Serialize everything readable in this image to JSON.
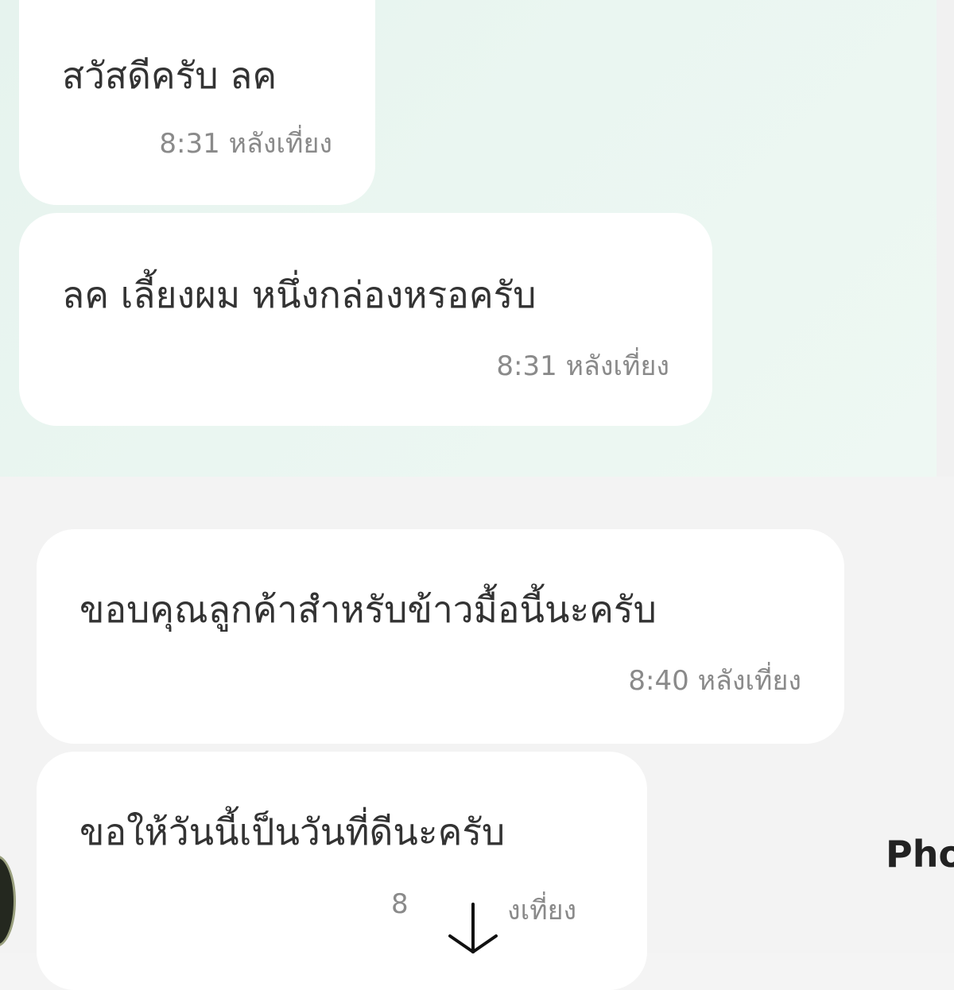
{
  "messages": [
    {
      "text": "สวัสดีครับ ลค",
      "time": "8:31 หลังเที่ยง"
    },
    {
      "text": "ลค เลี้ยงผม หนึ่งกล่องหรอครับ",
      "time": "8:31 หลังเที่ยง"
    },
    {
      "text": "ขอบคุณลูกค้าสำหรับข้าวมื้อนี้นะครับ",
      "time": "8:40 หลังเที่ยง"
    },
    {
      "text": "ขอให้วันนี้เป็นวันที่ดีนะครับ",
      "time_visible_start": "8",
      "time_visible_end": "งเที่ยง"
    }
  ],
  "side_label": "Pho",
  "icons": {
    "scroll_down": "arrow-down-icon",
    "avatar": "avatar"
  },
  "colors": {
    "bubble": "#ffffff",
    "text": "#333333",
    "time": "#8a8a8a",
    "top_bg": "#e9f5f0",
    "bottom_bg": "#f3f3f3"
  }
}
